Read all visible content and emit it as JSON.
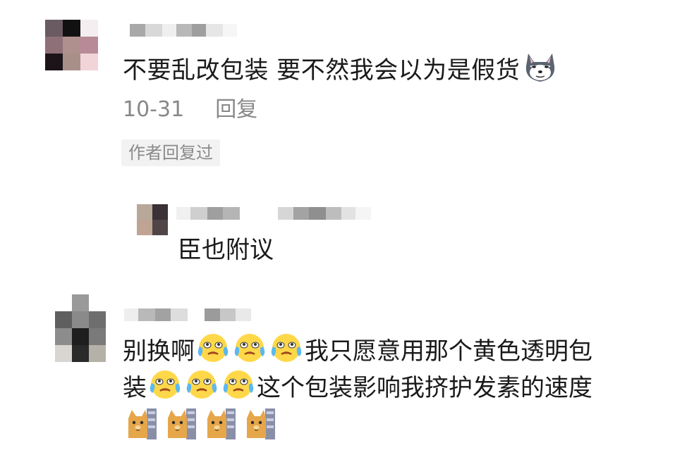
{
  "comments": [
    {
      "text": "不要乱改包装 要不然我会以为是假货",
      "emoji_icon": "doge-icon",
      "date": "10-31",
      "reply_label": "回复",
      "tag": "作者回复过",
      "replies": [
        {
          "text": "臣也附议"
        }
      ]
    },
    {
      "line1": "别换啊",
      "line1_after": "我只愿意用那个黄色透明包",
      "line2_start": "装",
      "line2_after": "这个包装影响我挤护发素的速度",
      "emoji_icon": "crying-face-icon",
      "sticker_icon": "cat-sticker-icon"
    }
  ]
}
